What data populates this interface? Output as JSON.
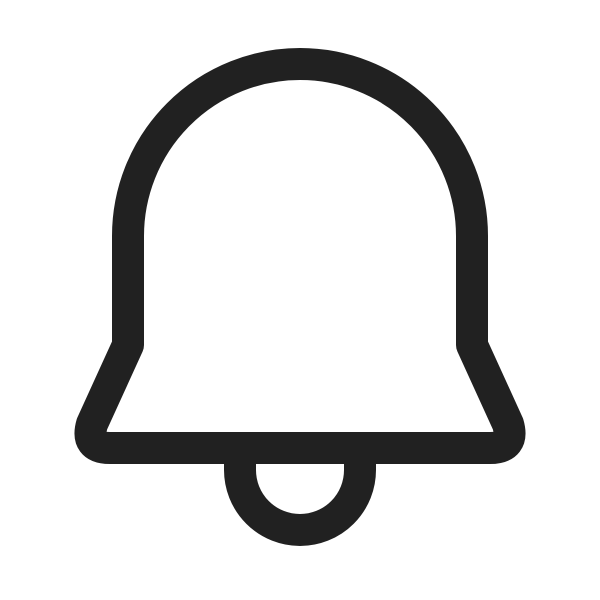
{
  "icon": {
    "name": "bell-icon",
    "style": "outline",
    "stroke_color": "#212121",
    "background_color": "#ffffff"
  }
}
